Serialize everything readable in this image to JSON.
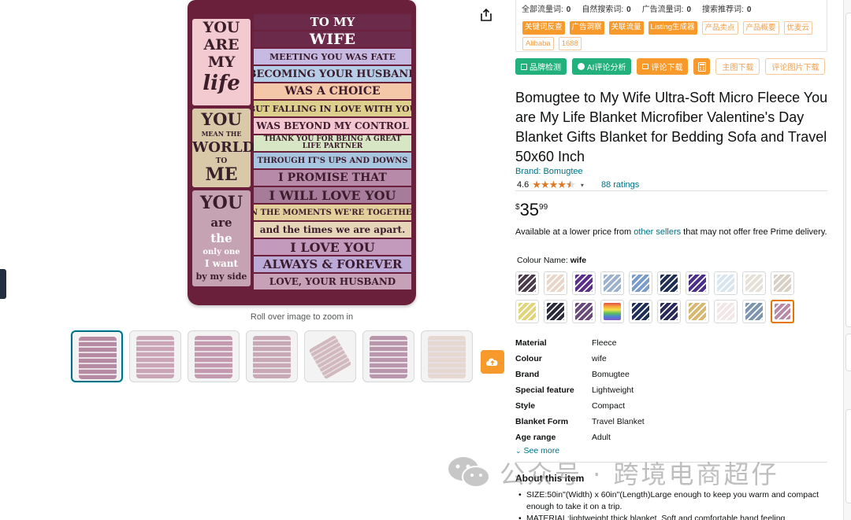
{
  "share_icon": "share-icon",
  "gallery": {
    "zoom_hint": "Roll over image to zoom in",
    "blanket": {
      "left_text": [
        "YOU",
        "ARE",
        "MY",
        "life",
        "YOU",
        "MEAN THE",
        "WORLD",
        "TO",
        "ME",
        "YOU",
        "are",
        "the",
        "only one",
        "I want",
        "by my side"
      ],
      "lines": [
        "TO MY",
        "WIFE",
        "MEETING YOU WAS FATE",
        "BECOMING YOUR HUSBAND",
        "WAS A CHOICE",
        "BUT FALLING IN LOVE WITH YOU",
        "WAS BEYOND MY CONTROL",
        "THANK YOU FOR BEING A GREAT LIFE PARTNER",
        "THROUGH IT'S UPS AND DOWNS",
        "I PROMISE THAT",
        "I WILL LOVE YOU",
        "IN THE MOMENTS WE'RE TOGETHER",
        "and the times we are apart.",
        "I LOVE YOU",
        "ALWAYS & FOREVER",
        "LOVE, YOUR HUSBAND"
      ]
    },
    "thumbnail_count": 7
  },
  "plugin": {
    "stats": [
      {
        "label": "全部流量词:",
        "value": "0"
      },
      {
        "label": "自然搜索词:",
        "value": "0"
      },
      {
        "label": "广告流量词:",
        "value": "0"
      },
      {
        "label": "搜索推荐词:",
        "value": "0"
      }
    ],
    "tags_solid": [
      "关键词反查",
      "广告洞察",
      "关联流量",
      "Listing生成器"
    ],
    "tags_outline": [
      "产品卖点",
      "产品概要",
      "优麦云",
      "Alibaba",
      "1688"
    ],
    "toolbar": {
      "brand_check": "品牌检测",
      "ai_review": "AI评论分析",
      "review_download": "评论下载",
      "main_image_download": "主图下载",
      "review_image_download": "评论图片下载"
    }
  },
  "product": {
    "title": "Bomugtee to My Wife Ultra-Soft Micro Fleece You are My Life Blanket Microfiber Valentine's Day Blanket Gifts Blanket for Bedding Sofa and Travel 50x60 Inch",
    "brand_link": "Brand: Bomugtee",
    "rating": "4.6",
    "rating_stars": 4.6,
    "ratings_count": "88 ratings",
    "price": {
      "symbol": "$",
      "whole": "35",
      "fraction": "99"
    },
    "availability_prefix": "Available at a lower price from ",
    "availability_link": "other sellers",
    "availability_suffix": " that may not offer free Prime delivery.",
    "colour_label": "Colour Name:",
    "colour_value": "wife",
    "swatch_count": 20,
    "selected_swatch": 20,
    "specs": [
      {
        "key": "Material",
        "value": "Fleece"
      },
      {
        "key": "Colour",
        "value": "wife"
      },
      {
        "key": "Brand",
        "value": "Bomugtee"
      },
      {
        "key": "Special feature",
        "value": "Lightweight"
      },
      {
        "key": "Style",
        "value": "Compact"
      },
      {
        "key": "Blanket Form",
        "value": "Travel Blanket"
      },
      {
        "key": "Age range",
        "value": "Adult"
      }
    ],
    "see_more": "See more",
    "about_title": "About this item",
    "about_items": [
      "SIZE:50in\"(Width) x 60in\"(Length)Large enough to keep you warm and compact enough to take it on a trip.",
      "MATERIAL:lightweight thick blanket. Soft and comfortable hand feeling"
    ]
  },
  "watermark": "公众号 · 跨境电商超仔",
  "colors": {
    "accent_orange": "#f79a2b",
    "accent_green": "#22b07d",
    "link": "#007185",
    "star": "#de7921",
    "selected_border": "#e77600"
  }
}
